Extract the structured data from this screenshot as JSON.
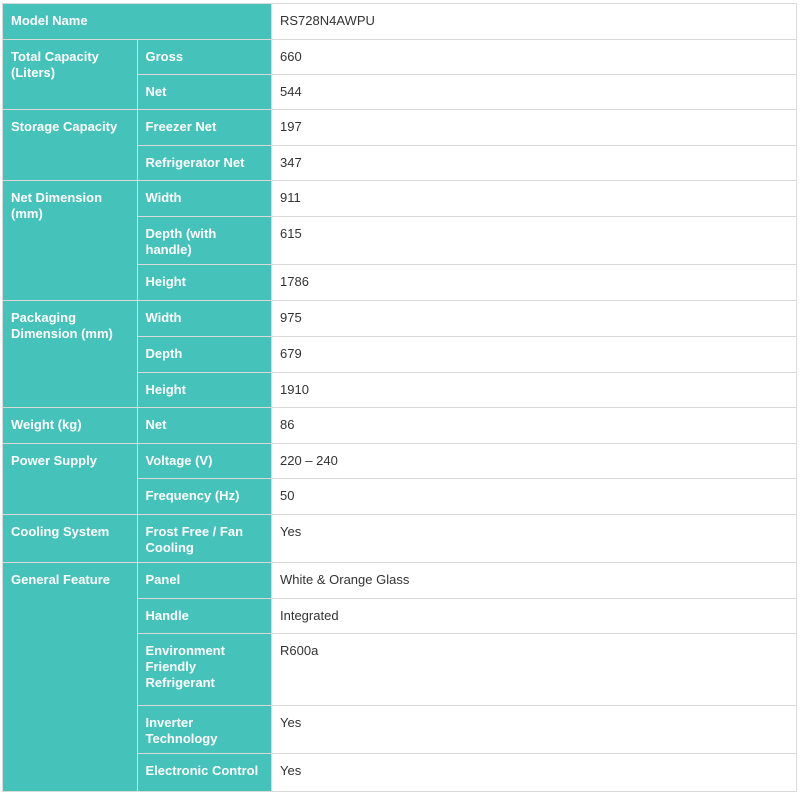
{
  "model": {
    "label": "Model Name",
    "value": "RS728N4AWPU"
  },
  "groups": [
    {
      "category": "Total Capacity (Liters)",
      "rows": [
        {
          "label": "Gross",
          "value": "660"
        },
        {
          "label": "Net",
          "value": "544"
        }
      ]
    },
    {
      "category": "Storage Capacity",
      "rows": [
        {
          "label": "Freezer Net",
          "value": "197"
        },
        {
          "label": "Refrigerator Net",
          "value": "347"
        }
      ]
    },
    {
      "category": "Net Dimension (mm)",
      "rows": [
        {
          "label": "Width",
          "value": "911"
        },
        {
          "label": "Depth (with handle)",
          "value": "615"
        },
        {
          "label": "Height",
          "value": "1786"
        }
      ]
    },
    {
      "category": "Packaging Dimension (mm)",
      "rows": [
        {
          "label": "Width",
          "value": "975"
        },
        {
          "label": "Depth",
          "value": "679"
        },
        {
          "label": "Height",
          "value": "1910"
        }
      ]
    },
    {
      "category": "Weight (kg)",
      "rows": [
        {
          "label": "Net",
          "value": "86"
        }
      ]
    },
    {
      "category": "Power Supply",
      "rows": [
        {
          "label": "Voltage (V)",
          "value": "220 – 240"
        },
        {
          "label": "Frequency (Hz)",
          "value": "50"
        }
      ]
    },
    {
      "category": "Cooling System",
      "rows": [
        {
          "label": "Frost Free / Fan Cooling",
          "value": "Yes"
        }
      ]
    },
    {
      "category": "General Feature",
      "rows": [
        {
          "label": "Panel",
          "value": "White & Orange Glass"
        },
        {
          "label": "Handle",
          "value": "Integrated"
        },
        {
          "label": "Environment Friendly Refrigerant",
          "value": "R600a"
        },
        {
          "label": "Inverter Technology",
          "value": "Yes"
        },
        {
          "label": "Electronic Control",
          "value": "Yes"
        }
      ]
    }
  ],
  "colors": {
    "header_bg": "#45c2b9",
    "header_text": "#ffffff",
    "value_text": "#333333",
    "border": "#d9d9d9"
  }
}
